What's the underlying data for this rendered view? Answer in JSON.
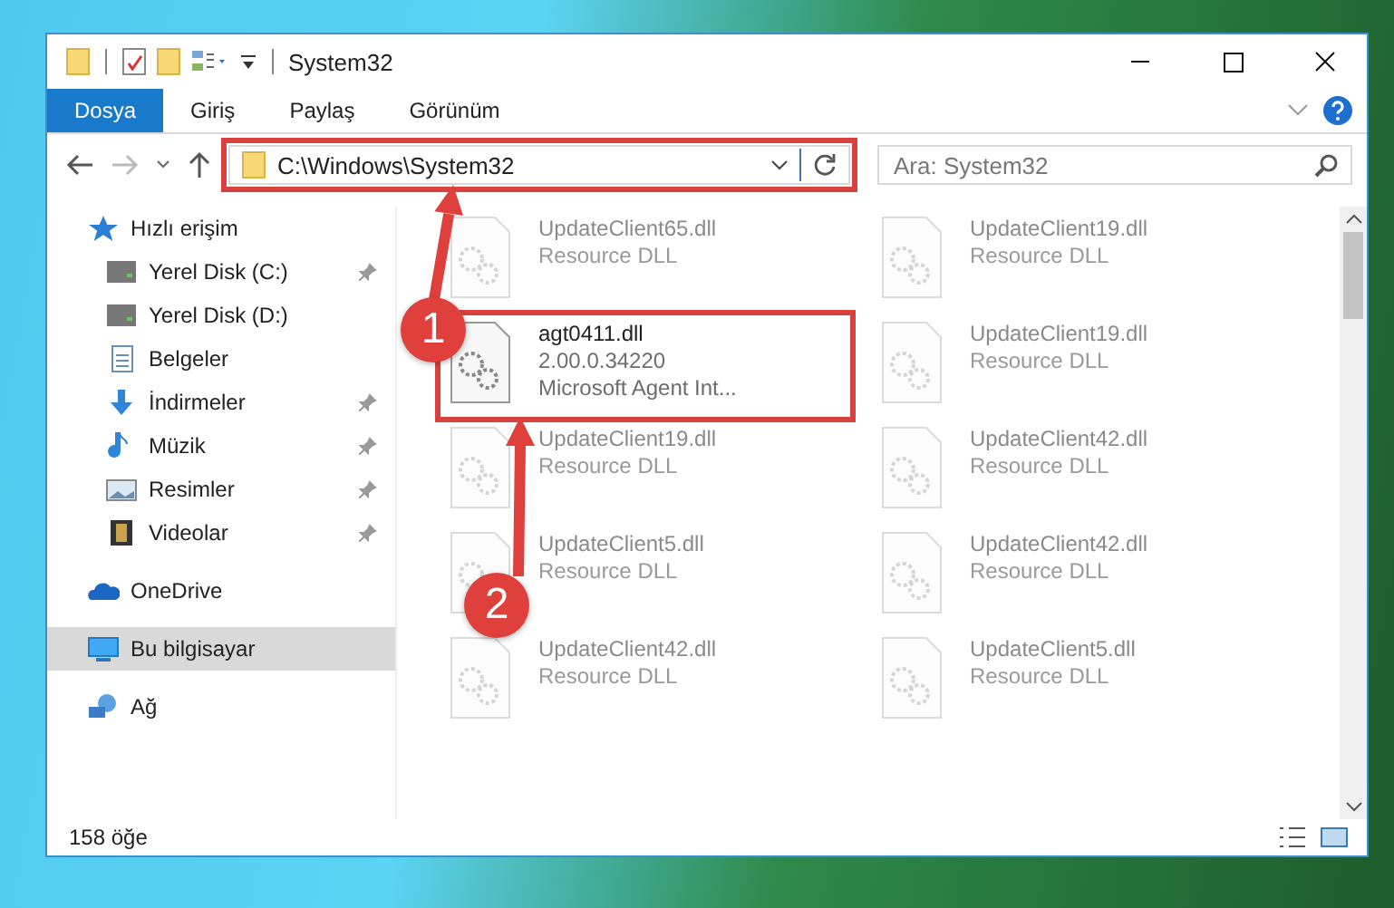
{
  "window": {
    "title": "System32"
  },
  "ribbon_tabs": [
    {
      "label": "Dosya",
      "selected": true
    },
    {
      "label": "Giriş",
      "selected": false
    },
    {
      "label": "Paylaş",
      "selected": false
    },
    {
      "label": "Görünüm",
      "selected": false
    }
  ],
  "address_bar": {
    "path": "C:\\Windows\\System32",
    "highlighted": true
  },
  "search": {
    "placeholder": "Ara: System32"
  },
  "sidebar": {
    "items": [
      {
        "label": "Hızlı erişim",
        "kind": "star",
        "pinned": false,
        "selected": false,
        "child": false
      },
      {
        "label": "Yerel Disk (C:)",
        "kind": "drive",
        "pinned": true,
        "selected": false,
        "child": true
      },
      {
        "label": "Yerel Disk (D:)",
        "kind": "drive",
        "pinned": false,
        "selected": false,
        "child": true
      },
      {
        "label": "Belgeler",
        "kind": "doc",
        "pinned": false,
        "selected": false,
        "child": true
      },
      {
        "label": "İndirmeler",
        "kind": "download",
        "pinned": true,
        "selected": false,
        "child": true
      },
      {
        "label": "Müzik",
        "kind": "music",
        "pinned": true,
        "selected": false,
        "child": true
      },
      {
        "label": "Resimler",
        "kind": "picture",
        "pinned": true,
        "selected": false,
        "child": true
      },
      {
        "label": "Videolar",
        "kind": "video",
        "pinned": true,
        "selected": false,
        "child": true
      },
      {
        "label": "OneDrive",
        "kind": "cloud",
        "pinned": false,
        "selected": false,
        "child": false
      },
      {
        "label": "Bu bilgisayar",
        "kind": "computer",
        "pinned": false,
        "selected": true,
        "child": false
      },
      {
        "label": "Ağ",
        "kind": "network",
        "pinned": false,
        "selected": false,
        "child": false
      }
    ]
  },
  "files": [
    {
      "name": "UpdateClient65.dll",
      "lines": [
        "Resource DLL"
      ],
      "faded": true,
      "highlighted": false
    },
    {
      "name": "UpdateClient19.dll",
      "lines": [
        "Resource DLL"
      ],
      "faded": true,
      "highlighted": false
    },
    {
      "name": "agt0411.dll",
      "lines": [
        "2.00.0.34220",
        "Microsoft Agent Int..."
      ],
      "faded": false,
      "highlighted": true
    },
    {
      "name": "UpdateClient19.dll",
      "lines": [
        "Resource DLL"
      ],
      "faded": true,
      "highlighted": false
    },
    {
      "name": "UpdateClient19.dll",
      "lines": [
        "Resource DLL"
      ],
      "faded": true,
      "highlighted": false
    },
    {
      "name": "UpdateClient42.dll",
      "lines": [
        "Resource DLL"
      ],
      "faded": true,
      "highlighted": false
    },
    {
      "name": "UpdateClient5.dll",
      "lines": [
        "Resource DLL"
      ],
      "faded": true,
      "highlighted": false
    },
    {
      "name": "UpdateClient42.dll",
      "lines": [
        "Resource DLL"
      ],
      "faded": true,
      "highlighted": false
    },
    {
      "name": "UpdateClient42.dll",
      "lines": [
        "Resource DLL"
      ],
      "faded": true,
      "highlighted": false
    },
    {
      "name": "UpdateClient5.dll",
      "lines": [
        "Resource DLL"
      ],
      "faded": true,
      "highlighted": false
    }
  ],
  "status_bar": {
    "count": "158 öğe"
  },
  "callouts": [
    {
      "label": "1"
    },
    {
      "label": "2"
    }
  ]
}
